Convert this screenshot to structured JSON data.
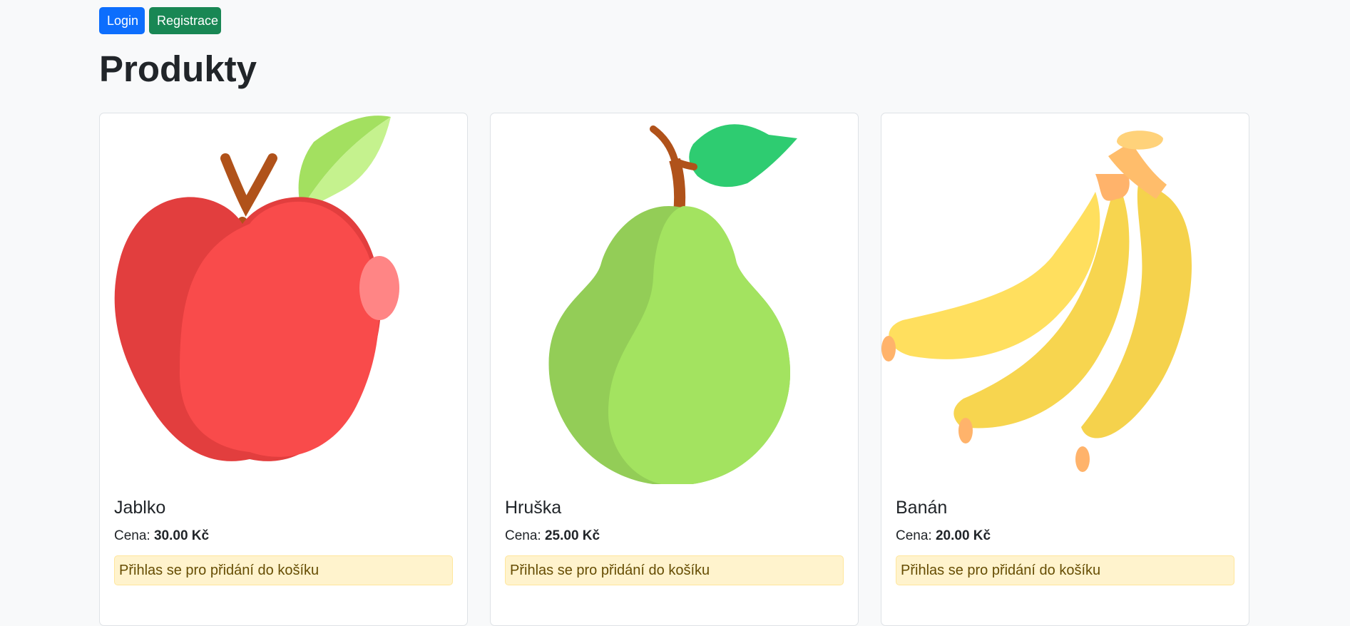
{
  "header": {
    "login_label": "Login",
    "register_label": "Registrace"
  },
  "page_title": "Produkty",
  "products": [
    {
      "name": "Jablko",
      "price_label": "Cena:",
      "price": "30.00 Kč",
      "notice": "Přihlas se pro přidání do košíku",
      "image_icon": "apple-icon"
    },
    {
      "name": "Hruška",
      "price_label": "Cena:",
      "price": "25.00 Kč",
      "notice": "Přihlas se pro přidání do košíku",
      "image_icon": "pear-icon"
    },
    {
      "name": "Banán",
      "price_label": "Cena:",
      "price": "20.00 Kč",
      "notice": "Přihlas se pro přidání do košíku",
      "image_icon": "banana-icon"
    }
  ],
  "colors": {
    "primary": "#0d6efd",
    "success": "#198754",
    "alert_bg": "#fff3cd",
    "alert_text": "#664d03",
    "page_bg": "#f8f9fa"
  }
}
